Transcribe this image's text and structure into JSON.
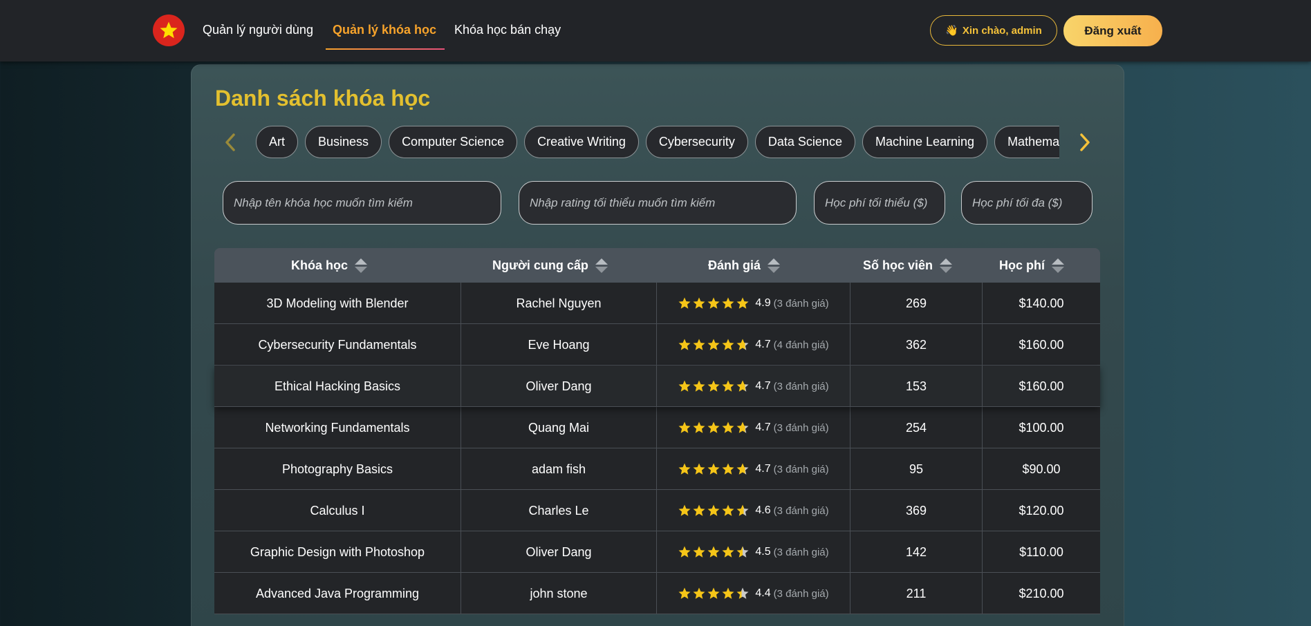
{
  "nav": {
    "links": [
      "Quản lý người dùng",
      "Quản lý khóa học",
      "Khóa học bán chạy"
    ],
    "greeting_icon": "👋",
    "greeting": "Xin chào, admin",
    "logout": "Đăng xuất"
  },
  "page": {
    "title": "Danh sách khóa học"
  },
  "categories": [
    "Art",
    "Business",
    "Computer Science",
    "Creative Writing",
    "Cybersecurity",
    "Data Science",
    "Machine Learning",
    "Mathematics"
  ],
  "filters": {
    "name_placeholder": "Nhập tên khóa học muốn tìm kiếm",
    "rating_placeholder": "Nhập rating tối thiểu muốn tìm kiếm",
    "min_fee_placeholder": "Học phí tối thiểu ($)",
    "max_fee_placeholder": "Học phí tối đa ($)"
  },
  "table": {
    "headers": [
      "Khóa học",
      "Người cung cấp",
      "Đánh giá",
      "Số học viên",
      "Học phí"
    ],
    "rows": [
      {
        "course": "3D Modeling with Blender",
        "provider": "Rachel Nguyen",
        "rating": "4.9",
        "reviews": "(3 đánh giá)",
        "students": "269",
        "fee": "$140.00"
      },
      {
        "course": "Cybersecurity Fundamentals",
        "provider": "Eve Hoang",
        "rating": "4.7",
        "reviews": "(4 đánh giá)",
        "students": "362",
        "fee": "$160.00"
      },
      {
        "course": "Ethical Hacking Basics",
        "provider": "Oliver Dang",
        "rating": "4.7",
        "reviews": "(3 đánh giá)",
        "students": "153",
        "fee": "$160.00"
      },
      {
        "course": "Networking Fundamentals",
        "provider": "Quang Mai",
        "rating": "4.7",
        "reviews": "(3 đánh giá)",
        "students": "254",
        "fee": "$100.00"
      },
      {
        "course": "Photography Basics",
        "provider": "adam fish",
        "rating": "4.7",
        "reviews": "(3 đánh giá)",
        "students": "95",
        "fee": "$90.00"
      },
      {
        "course": "Calculus I",
        "provider": "Charles Le",
        "rating": "4.6",
        "reviews": "(3 đánh giá)",
        "students": "369",
        "fee": "$120.00"
      },
      {
        "course": "Graphic Design with Photoshop",
        "provider": "Oliver Dang",
        "rating": "4.5",
        "reviews": "(3 đánh giá)",
        "students": "142",
        "fee": "$110.00"
      },
      {
        "course": "Advanced Java Programming",
        "provider": "john stone",
        "rating": "4.4",
        "reviews": "(3 đánh giá)",
        "students": "211",
        "fee": "$210.00"
      }
    ]
  },
  "colors": {
    "accent": "#f7a32b",
    "title": "#e3c02f",
    "star": "#f5c518",
    "flag_red": "#da251d"
  }
}
